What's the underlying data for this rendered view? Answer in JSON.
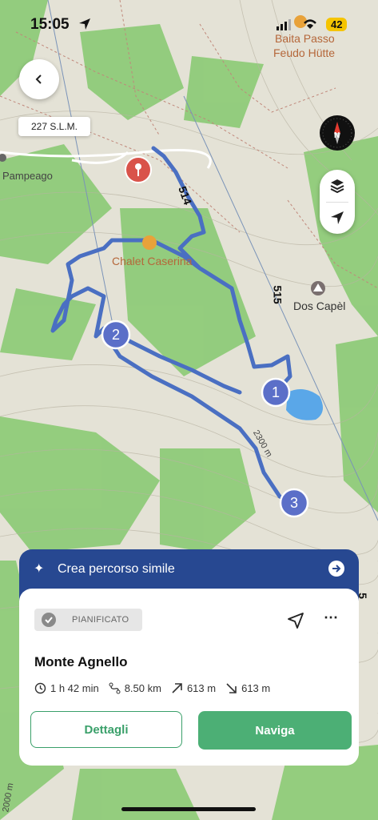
{
  "status_bar": {
    "time": "15:05",
    "battery": "42"
  },
  "map": {
    "labels": {
      "pampeago": "Pampeago",
      "chalet": "Chalet Caserina",
      "baita_line1": "Baita Passo",
      "baita_line2": "Feudo Hütte",
      "dos_capel": "Dos Capèl",
      "trail_514": "514",
      "trail_515": "515",
      "contour_2300": "2300 m",
      "contour_2000": "2000 m",
      "edge_number": "5"
    },
    "waypoints": [
      "1",
      "2",
      "3"
    ],
    "elevation_badge": "227 S.L.M.",
    "colors": {
      "route": "#4a6fc2",
      "waypoint": "#5b6fc8",
      "pin": "#d9534a",
      "lake": "#5aa7e8",
      "forest": "#7fc46a"
    }
  },
  "controls": {
    "back_icon": "chevron-left",
    "compass_label": "N"
  },
  "banner": {
    "label": "Crea percorso simile"
  },
  "card": {
    "status": "PIANIFICATO",
    "title": "Monte Agnello",
    "stats": {
      "duration": "1 h 42 min",
      "distance": "8.50 km",
      "ascent": "613 m",
      "descent": "613 m"
    },
    "details_button": "Dettagli",
    "navigate_button": "Naviga"
  }
}
